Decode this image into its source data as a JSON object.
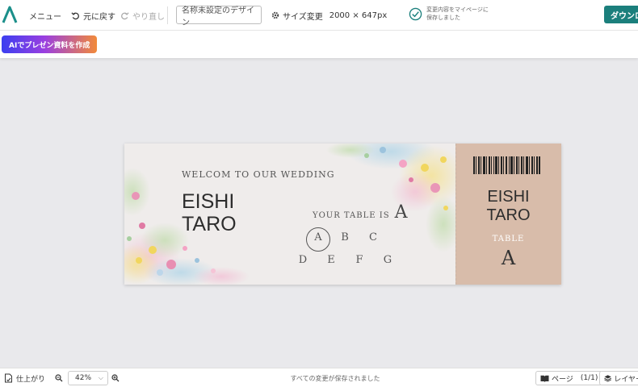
{
  "topbar": {
    "menu_label": "メニュー",
    "undo_label": "元に戻す",
    "redo_label": "やり直し",
    "title_value": "名称未設定のデザイン",
    "size_label": "サイズ変更",
    "size_dims": "2000 × 647px",
    "save_status_line1": "変更内容をマイページに",
    "save_status_line2": "保存しました",
    "download_label": "ダウンロ"
  },
  "subbar": {
    "ai_label": "AIでプレゼン資料を作成"
  },
  "card": {
    "welcome": "WELCOM TO OUR WEDDING",
    "name_line1": "EISHI",
    "name_line2": "TARO",
    "your_table_label": "YOUR TABLE IS",
    "your_table_letter": "A",
    "table_letters": [
      "A",
      "B",
      "C",
      "D",
      "E",
      "F",
      "G"
    ],
    "stub_name_line1": "EISHI",
    "stub_name_line2": "TARO",
    "stub_table_label": "TABLE",
    "stub_table_letter": "A",
    "colors": {
      "main_bg": "#efeceb",
      "stub_bg": "#d8bcaa"
    }
  },
  "bottombar": {
    "finish_label": "仕上がり",
    "zoom_value": "42%",
    "status_text": "すべての変更が保存されました",
    "page_label": "ページ",
    "page_count": "(1/1)",
    "layer_label": "レイヤー"
  },
  "colors": {
    "brand": "#1b7f7c",
    "canvas_bg": "#e9e9ec"
  }
}
